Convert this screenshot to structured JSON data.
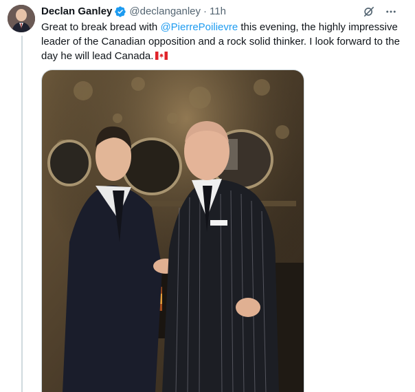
{
  "tweet": {
    "display_name": "Declan Ganley",
    "handle": "@declanganley",
    "separator": "·",
    "time": "11h",
    "text_before": "Great to break bread with ",
    "mention": "@PierrePoilievre",
    "text_after": " this evening, the highly impressive leader of the Canadian opposition and a rock solid thinker. I look forward to the day he will lead Canada.",
    "verified": true,
    "flag_icon": "canada-flag-icon",
    "photo_alt": "Two men in suits shaking hands in a decorated dining room"
  },
  "colors": {
    "link": "#1d9bf0",
    "verified": "#1d9bf0",
    "muted": "#536471",
    "text": "#0f1419",
    "thread_line": "#cfd9de"
  }
}
